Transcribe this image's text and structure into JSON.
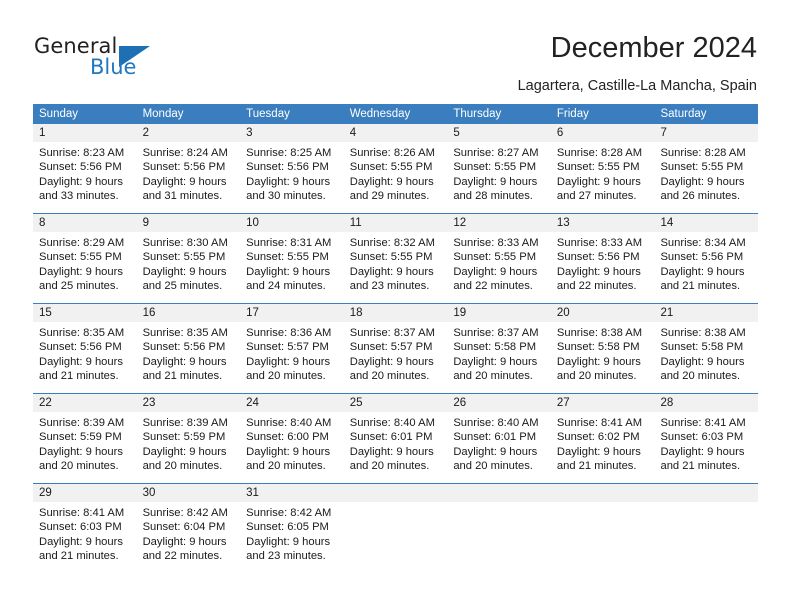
{
  "branding": {
    "logo_primary": "General",
    "logo_secondary": "Blue",
    "accent_color": "#1f6fb5"
  },
  "header": {
    "title": "December 2024",
    "subtitle": "Lagartera, Castille-La Mancha, Spain"
  },
  "calendar": {
    "header_bg": "#3a7ebf",
    "daynum_bg": "#f1f1f1",
    "weekdays": [
      "Sunday",
      "Monday",
      "Tuesday",
      "Wednesday",
      "Thursday",
      "Friday",
      "Saturday"
    ],
    "weeks": [
      {
        "days": [
          {
            "num": "1",
            "sunrise": "Sunrise: 8:23 AM",
            "sunset": "Sunset: 5:56 PM",
            "daylight_1": "Daylight: 9 hours",
            "daylight_2": "and 33 minutes."
          },
          {
            "num": "2",
            "sunrise": "Sunrise: 8:24 AM",
            "sunset": "Sunset: 5:56 PM",
            "daylight_1": "Daylight: 9 hours",
            "daylight_2": "and 31 minutes."
          },
          {
            "num": "3",
            "sunrise": "Sunrise: 8:25 AM",
            "sunset": "Sunset: 5:56 PM",
            "daylight_1": "Daylight: 9 hours",
            "daylight_2": "and 30 minutes."
          },
          {
            "num": "4",
            "sunrise": "Sunrise: 8:26 AM",
            "sunset": "Sunset: 5:55 PM",
            "daylight_1": "Daylight: 9 hours",
            "daylight_2": "and 29 minutes."
          },
          {
            "num": "5",
            "sunrise": "Sunrise: 8:27 AM",
            "sunset": "Sunset: 5:55 PM",
            "daylight_1": "Daylight: 9 hours",
            "daylight_2": "and 28 minutes."
          },
          {
            "num": "6",
            "sunrise": "Sunrise: 8:28 AM",
            "sunset": "Sunset: 5:55 PM",
            "daylight_1": "Daylight: 9 hours",
            "daylight_2": "and 27 minutes."
          },
          {
            "num": "7",
            "sunrise": "Sunrise: 8:28 AM",
            "sunset": "Sunset: 5:55 PM",
            "daylight_1": "Daylight: 9 hours",
            "daylight_2": "and 26 minutes."
          }
        ]
      },
      {
        "days": [
          {
            "num": "8",
            "sunrise": "Sunrise: 8:29 AM",
            "sunset": "Sunset: 5:55 PM",
            "daylight_1": "Daylight: 9 hours",
            "daylight_2": "and 25 minutes."
          },
          {
            "num": "9",
            "sunrise": "Sunrise: 8:30 AM",
            "sunset": "Sunset: 5:55 PM",
            "daylight_1": "Daylight: 9 hours",
            "daylight_2": "and 25 minutes."
          },
          {
            "num": "10",
            "sunrise": "Sunrise: 8:31 AM",
            "sunset": "Sunset: 5:55 PM",
            "daylight_1": "Daylight: 9 hours",
            "daylight_2": "and 24 minutes."
          },
          {
            "num": "11",
            "sunrise": "Sunrise: 8:32 AM",
            "sunset": "Sunset: 5:55 PM",
            "daylight_1": "Daylight: 9 hours",
            "daylight_2": "and 23 minutes."
          },
          {
            "num": "12",
            "sunrise": "Sunrise: 8:33 AM",
            "sunset": "Sunset: 5:55 PM",
            "daylight_1": "Daylight: 9 hours",
            "daylight_2": "and 22 minutes."
          },
          {
            "num": "13",
            "sunrise": "Sunrise: 8:33 AM",
            "sunset": "Sunset: 5:56 PM",
            "daylight_1": "Daylight: 9 hours",
            "daylight_2": "and 22 minutes."
          },
          {
            "num": "14",
            "sunrise": "Sunrise: 8:34 AM",
            "sunset": "Sunset: 5:56 PM",
            "daylight_1": "Daylight: 9 hours",
            "daylight_2": "and 21 minutes."
          }
        ]
      },
      {
        "days": [
          {
            "num": "15",
            "sunrise": "Sunrise: 8:35 AM",
            "sunset": "Sunset: 5:56 PM",
            "daylight_1": "Daylight: 9 hours",
            "daylight_2": "and 21 minutes."
          },
          {
            "num": "16",
            "sunrise": "Sunrise: 8:35 AM",
            "sunset": "Sunset: 5:56 PM",
            "daylight_1": "Daylight: 9 hours",
            "daylight_2": "and 21 minutes."
          },
          {
            "num": "17",
            "sunrise": "Sunrise: 8:36 AM",
            "sunset": "Sunset: 5:57 PM",
            "daylight_1": "Daylight: 9 hours",
            "daylight_2": "and 20 minutes."
          },
          {
            "num": "18",
            "sunrise": "Sunrise: 8:37 AM",
            "sunset": "Sunset: 5:57 PM",
            "daylight_1": "Daylight: 9 hours",
            "daylight_2": "and 20 minutes."
          },
          {
            "num": "19",
            "sunrise": "Sunrise: 8:37 AM",
            "sunset": "Sunset: 5:58 PM",
            "daylight_1": "Daylight: 9 hours",
            "daylight_2": "and 20 minutes."
          },
          {
            "num": "20",
            "sunrise": "Sunrise: 8:38 AM",
            "sunset": "Sunset: 5:58 PM",
            "daylight_1": "Daylight: 9 hours",
            "daylight_2": "and 20 minutes."
          },
          {
            "num": "21",
            "sunrise": "Sunrise: 8:38 AM",
            "sunset": "Sunset: 5:58 PM",
            "daylight_1": "Daylight: 9 hours",
            "daylight_2": "and 20 minutes."
          }
        ]
      },
      {
        "days": [
          {
            "num": "22",
            "sunrise": "Sunrise: 8:39 AM",
            "sunset": "Sunset: 5:59 PM",
            "daylight_1": "Daylight: 9 hours",
            "daylight_2": "and 20 minutes."
          },
          {
            "num": "23",
            "sunrise": "Sunrise: 8:39 AM",
            "sunset": "Sunset: 5:59 PM",
            "daylight_1": "Daylight: 9 hours",
            "daylight_2": "and 20 minutes."
          },
          {
            "num": "24",
            "sunrise": "Sunrise: 8:40 AM",
            "sunset": "Sunset: 6:00 PM",
            "daylight_1": "Daylight: 9 hours",
            "daylight_2": "and 20 minutes."
          },
          {
            "num": "25",
            "sunrise": "Sunrise: 8:40 AM",
            "sunset": "Sunset: 6:01 PM",
            "daylight_1": "Daylight: 9 hours",
            "daylight_2": "and 20 minutes."
          },
          {
            "num": "26",
            "sunrise": "Sunrise: 8:40 AM",
            "sunset": "Sunset: 6:01 PM",
            "daylight_1": "Daylight: 9 hours",
            "daylight_2": "and 20 minutes."
          },
          {
            "num": "27",
            "sunrise": "Sunrise: 8:41 AM",
            "sunset": "Sunset: 6:02 PM",
            "daylight_1": "Daylight: 9 hours",
            "daylight_2": "and 21 minutes."
          },
          {
            "num": "28",
            "sunrise": "Sunrise: 8:41 AM",
            "sunset": "Sunset: 6:03 PM",
            "daylight_1": "Daylight: 9 hours",
            "daylight_2": "and 21 minutes."
          }
        ]
      },
      {
        "days": [
          {
            "num": "29",
            "sunrise": "Sunrise: 8:41 AM",
            "sunset": "Sunset: 6:03 PM",
            "daylight_1": "Daylight: 9 hours",
            "daylight_2": "and 21 minutes."
          },
          {
            "num": "30",
            "sunrise": "Sunrise: 8:42 AM",
            "sunset": "Sunset: 6:04 PM",
            "daylight_1": "Daylight: 9 hours",
            "daylight_2": "and 22 minutes."
          },
          {
            "num": "31",
            "sunrise": "Sunrise: 8:42 AM",
            "sunset": "Sunset: 6:05 PM",
            "daylight_1": "Daylight: 9 hours",
            "daylight_2": "and 23 minutes."
          },
          {
            "num": "",
            "sunrise": "",
            "sunset": "",
            "daylight_1": "",
            "daylight_2": ""
          },
          {
            "num": "",
            "sunrise": "",
            "sunset": "",
            "daylight_1": "",
            "daylight_2": ""
          },
          {
            "num": "",
            "sunrise": "",
            "sunset": "",
            "daylight_1": "",
            "daylight_2": ""
          },
          {
            "num": "",
            "sunrise": "",
            "sunset": "",
            "daylight_1": "",
            "daylight_2": ""
          }
        ]
      }
    ]
  }
}
